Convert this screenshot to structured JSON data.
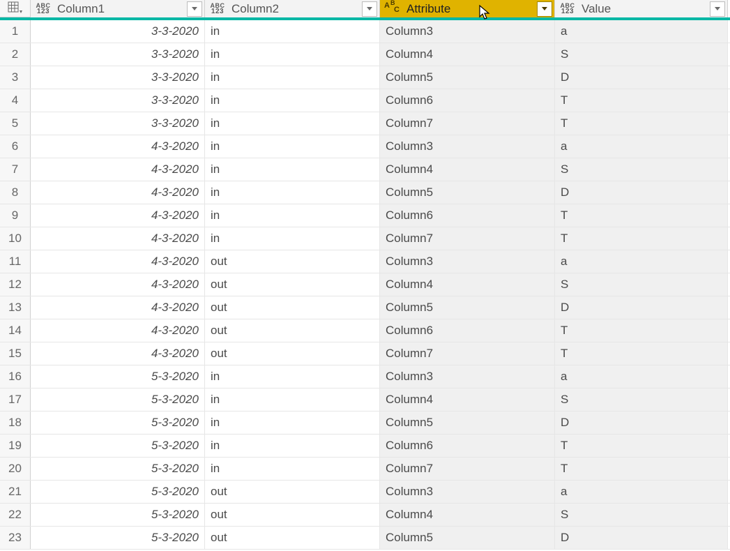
{
  "columns": [
    {
      "name": "Column1",
      "type_top": "ABC",
      "type_bottom": "123",
      "selected": false
    },
    {
      "name": "Column2",
      "type_top": "ABC",
      "type_bottom": "123",
      "selected": false
    },
    {
      "name": "Attribute",
      "type_top": "A",
      "type_bottom": "C",
      "type_mid": "B",
      "selected": true
    },
    {
      "name": "Value",
      "type_top": "ABC",
      "type_bottom": "123",
      "selected": false
    }
  ],
  "rows": [
    {
      "n": "1",
      "c1": "3-3-2020",
      "c2": "in",
      "c3": "Column3",
      "c4": "a"
    },
    {
      "n": "2",
      "c1": "3-3-2020",
      "c2": "in",
      "c3": "Column4",
      "c4": "S"
    },
    {
      "n": "3",
      "c1": "3-3-2020",
      "c2": "in",
      "c3": "Column5",
      "c4": "D"
    },
    {
      "n": "4",
      "c1": "3-3-2020",
      "c2": "in",
      "c3": "Column6",
      "c4": "T"
    },
    {
      "n": "5",
      "c1": "3-3-2020",
      "c2": "in",
      "c3": "Column7",
      "c4": "T"
    },
    {
      "n": "6",
      "c1": "4-3-2020",
      "c2": "in",
      "c3": "Column3",
      "c4": "a"
    },
    {
      "n": "7",
      "c1": "4-3-2020",
      "c2": "in",
      "c3": "Column4",
      "c4": "S"
    },
    {
      "n": "8",
      "c1": "4-3-2020",
      "c2": "in",
      "c3": "Column5",
      "c4": "D"
    },
    {
      "n": "9",
      "c1": "4-3-2020",
      "c2": "in",
      "c3": "Column6",
      "c4": "T"
    },
    {
      "n": "10",
      "c1": "4-3-2020",
      "c2": "in",
      "c3": "Column7",
      "c4": "T"
    },
    {
      "n": "11",
      "c1": "4-3-2020",
      "c2": "out",
      "c3": "Column3",
      "c4": "a"
    },
    {
      "n": "12",
      "c1": "4-3-2020",
      "c2": "out",
      "c3": "Column4",
      "c4": "S"
    },
    {
      "n": "13",
      "c1": "4-3-2020",
      "c2": "out",
      "c3": "Column5",
      "c4": "D"
    },
    {
      "n": "14",
      "c1": "4-3-2020",
      "c2": "out",
      "c3": "Column6",
      "c4": "T"
    },
    {
      "n": "15",
      "c1": "4-3-2020",
      "c2": "out",
      "c3": "Column7",
      "c4": "T"
    },
    {
      "n": "16",
      "c1": "5-3-2020",
      "c2": "in",
      "c3": "Column3",
      "c4": "a"
    },
    {
      "n": "17",
      "c1": "5-3-2020",
      "c2": "in",
      "c3": "Column4",
      "c4": "S"
    },
    {
      "n": "18",
      "c1": "5-3-2020",
      "c2": "in",
      "c3": "Column5",
      "c4": "D"
    },
    {
      "n": "19",
      "c1": "5-3-2020",
      "c2": "in",
      "c3": "Column6",
      "c4": "T"
    },
    {
      "n": "20",
      "c1": "5-3-2020",
      "c2": "in",
      "c3": "Column7",
      "c4": "T"
    },
    {
      "n": "21",
      "c1": "5-3-2020",
      "c2": "out",
      "c3": "Column3",
      "c4": "a"
    },
    {
      "n": "22",
      "c1": "5-3-2020",
      "c2": "out",
      "c3": "Column4",
      "c4": "S"
    },
    {
      "n": "23",
      "c1": "5-3-2020",
      "c2": "out",
      "c3": "Column5",
      "c4": "D"
    }
  ]
}
